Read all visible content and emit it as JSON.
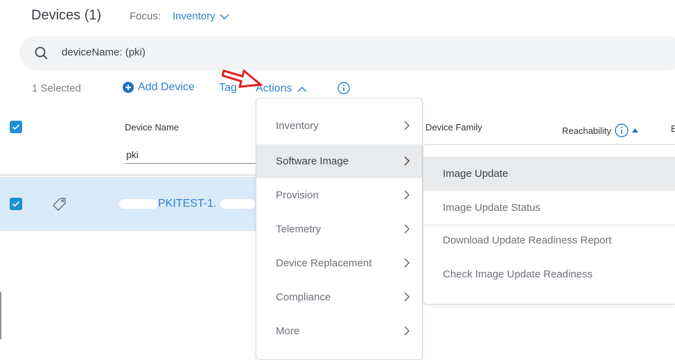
{
  "header": {
    "title": "Devices (1)",
    "focus_label": "Focus:",
    "focus_value": "Inventory"
  },
  "search": {
    "value": "deviceName: (pki)"
  },
  "toolbar": {
    "selected_count": "1 Selected",
    "add_device": "Add Device",
    "tag": "Tag",
    "actions": "Actions"
  },
  "table": {
    "columns": [
      "Device Name",
      "Device Family",
      "Reachability",
      "E"
    ],
    "filter_value": "pki",
    "rows": [
      {
        "device_name": "PKITEST-1.",
        "selected": true
      }
    ]
  },
  "actions_menu": {
    "items": [
      {
        "label": "Inventory"
      },
      {
        "label": "Software Image"
      },
      {
        "label": "Provision"
      },
      {
        "label": "Telemetry"
      },
      {
        "label": "Device Replacement"
      },
      {
        "label": "Compliance"
      },
      {
        "label": "More"
      }
    ],
    "active_index": 1
  },
  "software_image_submenu": {
    "items": [
      {
        "label": "Image Update"
      },
      {
        "label": "Image Update Status"
      },
      {
        "label": "Download Update Readiness Report"
      },
      {
        "label": "Check Image Update Readiness"
      }
    ],
    "active_index": 0
  },
  "colors": {
    "accent": "#2f7fd1",
    "checkbox": "#1f8fd6",
    "selected_row": "#d9eaf8",
    "annotation_arrow": "#e02020"
  }
}
